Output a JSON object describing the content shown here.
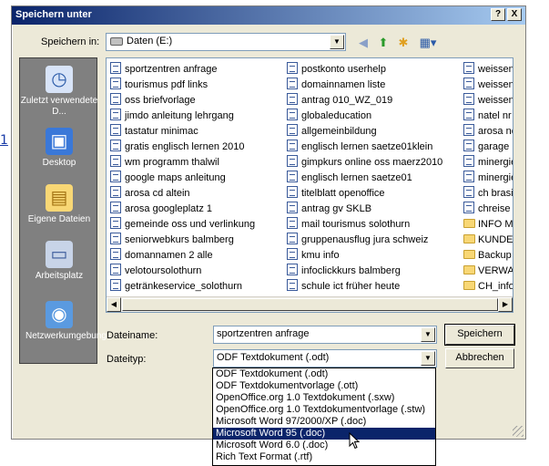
{
  "background": {
    "partial_digit": "1"
  },
  "dialog": {
    "title": "Speichern unter",
    "help_btn": "?",
    "close_btn": "X"
  },
  "lookin": {
    "label": "Speichern in:",
    "value": "Daten (E:)"
  },
  "places": [
    {
      "label": "Zuletzt verwendete D...",
      "icon": "recent-icon"
    },
    {
      "label": "Desktop",
      "icon": "desktop-icon"
    },
    {
      "label": "Eigene Dateien",
      "icon": "my-documents-icon"
    },
    {
      "label": "Arbeitsplatz",
      "icon": "my-computer-icon"
    },
    {
      "label": "Netzwerkumgebung",
      "icon": "network-icon"
    }
  ],
  "files": {
    "col1": [
      "sportzentren anfrage",
      "tourismus pdf links",
      "oss briefvorlage",
      "jimdo anleitung lehrgang",
      "tastatur minimac",
      "gratis englisch lernen 2010",
      "wm programm thalwil",
      "google maps anleitung",
      "arosa cd altein",
      "arosa googleplatz 1",
      "gemeinde oss und verlinkung",
      "seniorwebkurs balmberg",
      "domannamen 2 alle",
      "velotoursolothurn",
      "getränkeservice_solothurn"
    ],
    "col2": [
      "postkonto userhelp",
      "domainnamen liste",
      "antrag 010_WZ_019",
      "globaleducation",
      "allgemeinbildung",
      "englisch lernen saetze01klein",
      "gimpkurs online oss maerz2010",
      "englisch lernen saetze01",
      "titelblatt openoffice",
      "antrag gv SKLB",
      "mail tourismus solothurn",
      "gruppenausflug jura schweiz",
      "kmu info",
      "infoclickkurs balmberg",
      "schule ict früher heute"
    ],
    "col3": [
      {
        "name": "weissens",
        "type": "file"
      },
      {
        "name": "weissens",
        "type": "file"
      },
      {
        "name": "weissens",
        "type": "file"
      },
      {
        "name": "natel nr",
        "type": "file"
      },
      {
        "name": "arosa nc",
        "type": "file"
      },
      {
        "name": "garage h",
        "type": "file"
      },
      {
        "name": "minergie",
        "type": "file"
      },
      {
        "name": "minergie",
        "type": "file"
      },
      {
        "name": "ch brasili",
        "type": "file"
      },
      {
        "name": "chreise s",
        "type": "file"
      },
      {
        "name": "INFO MA",
        "type": "folder"
      },
      {
        "name": "KUNDEN",
        "type": "folder"
      },
      {
        "name": "Backup S",
        "type": "folder"
      },
      {
        "name": "VERWAL",
        "type": "folder"
      },
      {
        "name": "CH_info_",
        "type": "folder"
      }
    ]
  },
  "filename": {
    "label": "Dateiname:",
    "value": "sportzentren anfrage"
  },
  "filetype": {
    "label": "Dateityp:",
    "value": "ODF Textdokument (.odt)",
    "options": [
      "ODF Textdokument (.odt)",
      "ODF Textdokumentvorlage (.ott)",
      "OpenOffice.org 1.0 Textdokument (.sxw)",
      "OpenOffice.org 1.0 Textdokumentvorlage (.stw)",
      "Microsoft Word 97/2000/XP (.doc)",
      "Microsoft Word 95 (.doc)",
      "Microsoft Word 6.0 (.doc)",
      "Rich Text Format (.rtf)"
    ],
    "selected_index": 5
  },
  "buttons": {
    "save": "Speichern",
    "cancel": "Abbrechen"
  },
  "colors": {
    "selection": "#0a246a",
    "title_start": "#0a246a",
    "places_bg": "#808080"
  }
}
